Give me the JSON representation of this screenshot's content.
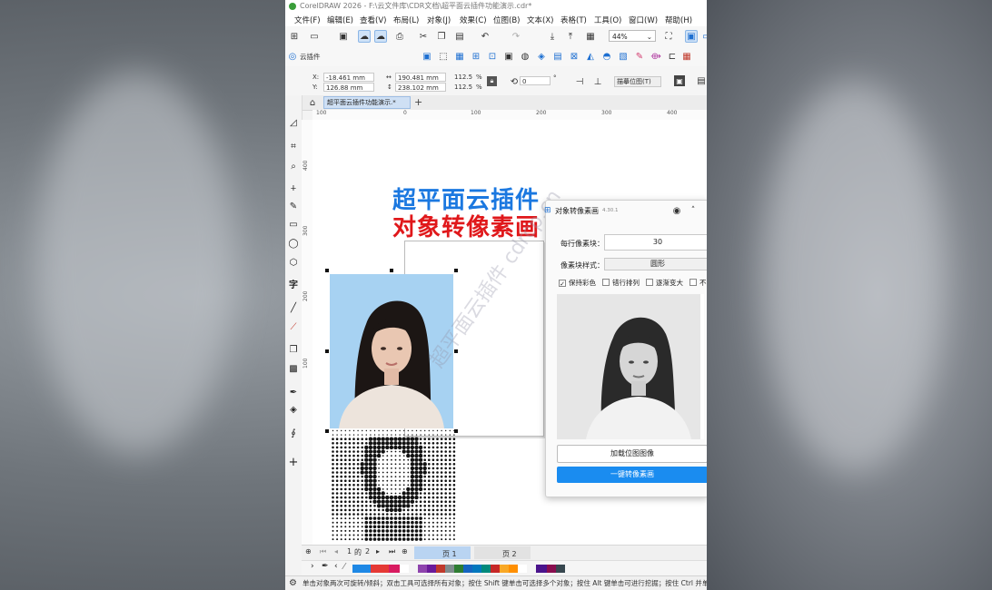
{
  "window": {
    "title": "CorelDRAW 2026 - F:\\云文件库\\CDR文档\\超平面云插件功能演示.cdr*"
  },
  "menu": [
    "文件(F)",
    "编辑(E)",
    "查看(V)",
    "布局(L)",
    "对象(J)",
    "效果(C)",
    "位图(B)",
    "文本(X)",
    "表格(T)",
    "工具(O)",
    "窗口(W)",
    "帮助(H)"
  ],
  "toolbar": {
    "zoom": "44%",
    "plugin_label": "云插件",
    "ps_badge": "Ps"
  },
  "propbar": {
    "x_label": "X:",
    "x": "-18.461 mm",
    "y_label": "Y:",
    "y": "126.88 mm",
    "w": "190.481 mm",
    "h": "238.102 mm",
    "scale_x": "112.5",
    "scale_y": "112.5",
    "pct": "%",
    "rotation": "0",
    "deg": "°",
    "trace_button": "描摹位图(T)"
  },
  "tabs": {
    "doc": "超平面云插件功能演示.*",
    "add": "+"
  },
  "ruler": {
    "h": [
      "100",
      "0",
      "100",
      "200",
      "300",
      "400"
    ],
    "v": [
      "400",
      "300",
      "200",
      "100"
    ]
  },
  "canvas": {
    "headline1": "超平面云插件",
    "headline2": "对象转像素画",
    "watermark": "超平面云插件 cdrcp.cn"
  },
  "dialog": {
    "title": "对象转像素画",
    "version": "4.30.1",
    "blocks_per_row_label": "每行像素块：",
    "blocks_per_row": "30",
    "style_label": "像素块样式：",
    "style_value": "圆形",
    "checkboxes": [
      {
        "label": "保持彩色",
        "checked": true
      },
      {
        "label": "错行排列",
        "checked": false
      },
      {
        "label": "逐渐变大",
        "checked": false
      },
      {
        "label": "不",
        "checked": false
      }
    ],
    "load_button": "加载位图图像",
    "convert_button": "一键转像素画"
  },
  "pagenav": {
    "current": "1",
    "of": "的",
    "total": "2",
    "page1": "页 1",
    "page2": "页 2"
  },
  "palette": [
    "#1e88e5",
    "#e53935",
    "#d81b60",
    "#ffffff",
    "#8e44ad",
    "#6a1b9a",
    "#c0392b",
    "#7f8c8d",
    "#2e7d32",
    "#1565c0",
    "#0277bd",
    "#00897b",
    "#c62828",
    "#f9a825",
    "#ff8f00",
    "#ffffff",
    "#4a148c",
    "#880e4f",
    "#37474f"
  ],
  "status": {
    "text": "单击对象两次可旋转/倾斜；双击工具可选择所有对象；按住 Shift 键单击可选择多个对象；按住 Alt 键单击可进行挖掘；按住 Ctrl 并单击可"
  }
}
